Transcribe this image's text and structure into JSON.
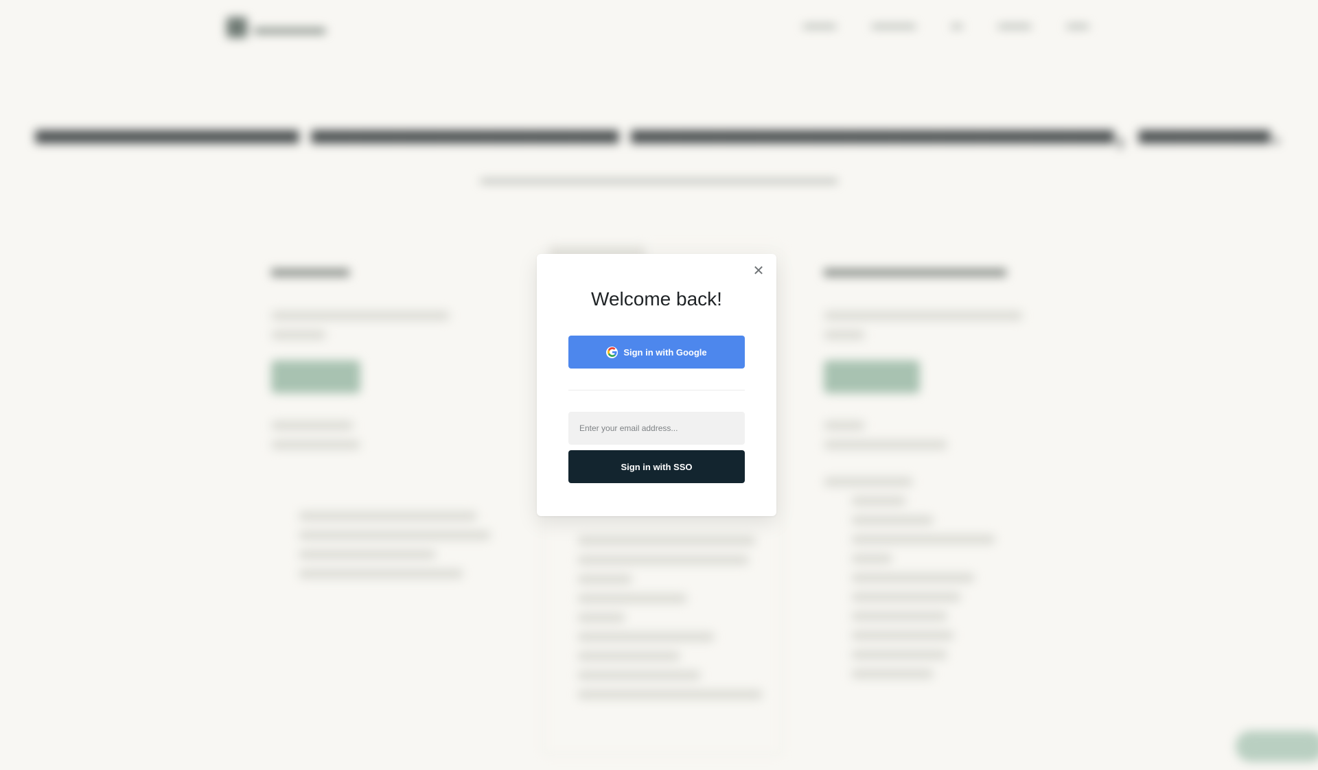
{
  "modal": {
    "title": "Welcome back!",
    "close_label": "✕",
    "google_button_label": "Sign in with Google",
    "email_placeholder": "Enter your email address...",
    "email_value": "",
    "sso_button_label": "Sign in with SSO"
  },
  "icons": {
    "close": "close-icon",
    "google": "google-icon"
  },
  "colors": {
    "google_button": "#4d87ed",
    "sso_button": "#13252f",
    "page_background": "#f8f7f3"
  }
}
